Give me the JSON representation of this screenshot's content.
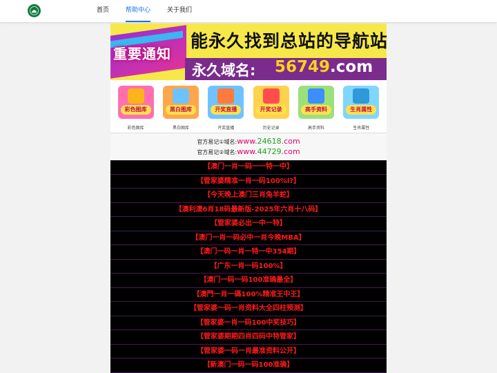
{
  "nav": {
    "items": [
      {
        "label": "首页",
        "active": false
      },
      {
        "label": "帮助中心",
        "active": true
      },
      {
        "label": "关于我们",
        "active": false
      }
    ]
  },
  "banner": {
    "tag": "重要通知",
    "headline": "能永久找到总站的导航站",
    "domain_label": "永久域名:",
    "domain_number": "56749",
    "domain_suffix": ".com"
  },
  "icons": [
    {
      "name": "color-gallery",
      "pill": "彩色图库",
      "caption": "彩色图库",
      "color": "#ff6fb0",
      "glyph": "#ffb31a"
    },
    {
      "name": "bw-gallery",
      "pill": "黑白图库",
      "caption": "黑白图库",
      "color": "#ffa64d",
      "glyph": "#6ec3ff"
    },
    {
      "name": "live-draw",
      "pill": "开奖直播",
      "caption": "开奖直播",
      "color": "#6ec3ff",
      "glyph": "#ff7a3d"
    },
    {
      "name": "history",
      "pill": "开奖记录",
      "caption": "历史记录",
      "color": "#ffd24d",
      "glyph": "#ff4d4d"
    },
    {
      "name": "expert-data",
      "pill": "高手资料",
      "caption": "高手资料",
      "color": "#9be07a",
      "glyph": "#3d8eff"
    },
    {
      "name": "zodiac",
      "pill": "生肖属性",
      "caption": "生肖属性",
      "color": "#7fd6ff",
      "glyph": "#2e9ad9"
    }
  ],
  "notices": [
    {
      "prefix": "官方易记①域名:",
      "www": "www.",
      "num": "24618",
      "tld": ".com"
    },
    {
      "prefix": "官方易记②域名:",
      "www": "www.",
      "num": "44729",
      "tld": ".com"
    }
  ],
  "list": [
    "【澳门一肖一码一一特一中】",
    "【管家婆精准一肖一码100%l?】",
    "【今天晚上澳门三肖兔羊蛇】",
    "【澳利澳6肖18码最新版-2025年六肖十八码】",
    "【管家婆必出一中一特】",
    "【澳门一肖一码必中一肖今晚MBA】",
    "【澳门一码一肖一特一中354期】",
    "【广东一肖一码100%】",
    "【澳门一码一码100准确最全】",
    "【澳門一肖一碼100%精准王中王】",
    "【管家婆一码一肖资料大全四柱预测】",
    "【管家婆一肖一码100中奖技巧】",
    "【管家婆期期四肖四码中特管家】",
    "【管家婆一码一肖最准资料公开】",
    "【新澳门一码一码100准确】"
  ],
  "colors": {
    "accent": "#1a73e8",
    "list_text": "#ff1a1a",
    "list_bg": "#000000"
  }
}
